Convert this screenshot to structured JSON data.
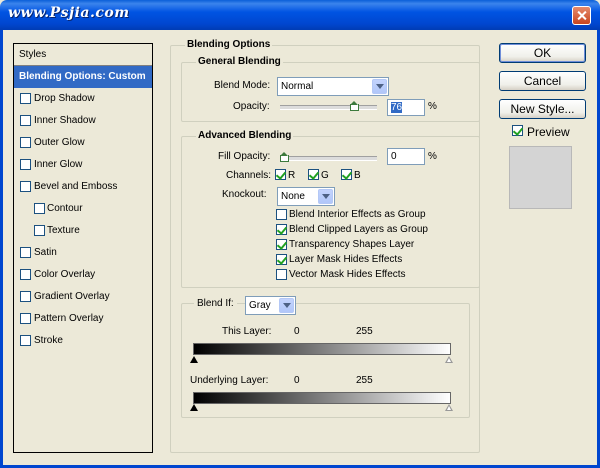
{
  "window": {
    "title": "www.Psjia.com"
  },
  "styles_panel": {
    "header": "Styles",
    "items": [
      {
        "label": "Blending Options: Custom",
        "checkbox": false,
        "selected": true,
        "indent": false
      },
      {
        "label": "Drop Shadow",
        "checkbox": true,
        "checked": false,
        "indent": false
      },
      {
        "label": "Inner Shadow",
        "checkbox": true,
        "checked": false,
        "indent": false
      },
      {
        "label": "Outer Glow",
        "checkbox": true,
        "checked": false,
        "indent": false
      },
      {
        "label": "Inner Glow",
        "checkbox": true,
        "checked": false,
        "indent": false
      },
      {
        "label": "Bevel and Emboss",
        "checkbox": true,
        "checked": false,
        "indent": false
      },
      {
        "label": "Contour",
        "checkbox": true,
        "checked": false,
        "indent": true
      },
      {
        "label": "Texture",
        "checkbox": true,
        "checked": false,
        "indent": true
      },
      {
        "label": "Satin",
        "checkbox": true,
        "checked": false,
        "indent": false
      },
      {
        "label": "Color Overlay",
        "checkbox": true,
        "checked": false,
        "indent": false
      },
      {
        "label": "Gradient Overlay",
        "checkbox": true,
        "checked": false,
        "indent": false
      },
      {
        "label": "Pattern Overlay",
        "checkbox": true,
        "checked": false,
        "indent": false
      },
      {
        "label": "Stroke",
        "checkbox": true,
        "checked": false,
        "indent": false
      }
    ]
  },
  "blending_options": {
    "title": "Blending Options",
    "general": {
      "title": "General Blending",
      "blend_mode_label": "Blend Mode:",
      "blend_mode_value": "Normal",
      "opacity_label": "Opacity:",
      "opacity_value": "76",
      "opacity_fraction": 0.76,
      "percent": "%"
    },
    "advanced": {
      "title": "Advanced Blending",
      "fill_opacity_label": "Fill Opacity:",
      "fill_opacity_value": "0",
      "fill_opacity_fraction": 0,
      "percent": "%",
      "channels_label": "Channels:",
      "channels": [
        {
          "label": "R",
          "checked": true
        },
        {
          "label": "G",
          "checked": true
        },
        {
          "label": "B",
          "checked": true
        }
      ],
      "knockout_label": "Knockout:",
      "knockout_value": "None",
      "options": [
        {
          "label": "Blend Interior Effects as Group",
          "checked": false
        },
        {
          "label": "Blend Clipped Layers as Group",
          "checked": true
        },
        {
          "label": "Transparency Shapes Layer",
          "checked": true
        },
        {
          "label": "Layer Mask Hides Effects",
          "checked": true
        },
        {
          "label": "Vector Mask Hides Effects",
          "checked": false
        }
      ]
    },
    "blend_if": {
      "label": "Blend If:",
      "value": "Gray",
      "this_layer": {
        "label": "This Layer:",
        "low": "0",
        "high": "255"
      },
      "underlying_layer": {
        "label": "Underlying Layer:",
        "low": "0",
        "high": "255"
      }
    }
  },
  "buttons": {
    "ok": "OK",
    "cancel": "Cancel",
    "new_style": "New Style...",
    "preview_label": "Preview",
    "preview_checked": true
  },
  "colors": {
    "titlebar": "#0054e3",
    "selection": "#316ac5",
    "dialog_bg": "#ece9d8"
  }
}
